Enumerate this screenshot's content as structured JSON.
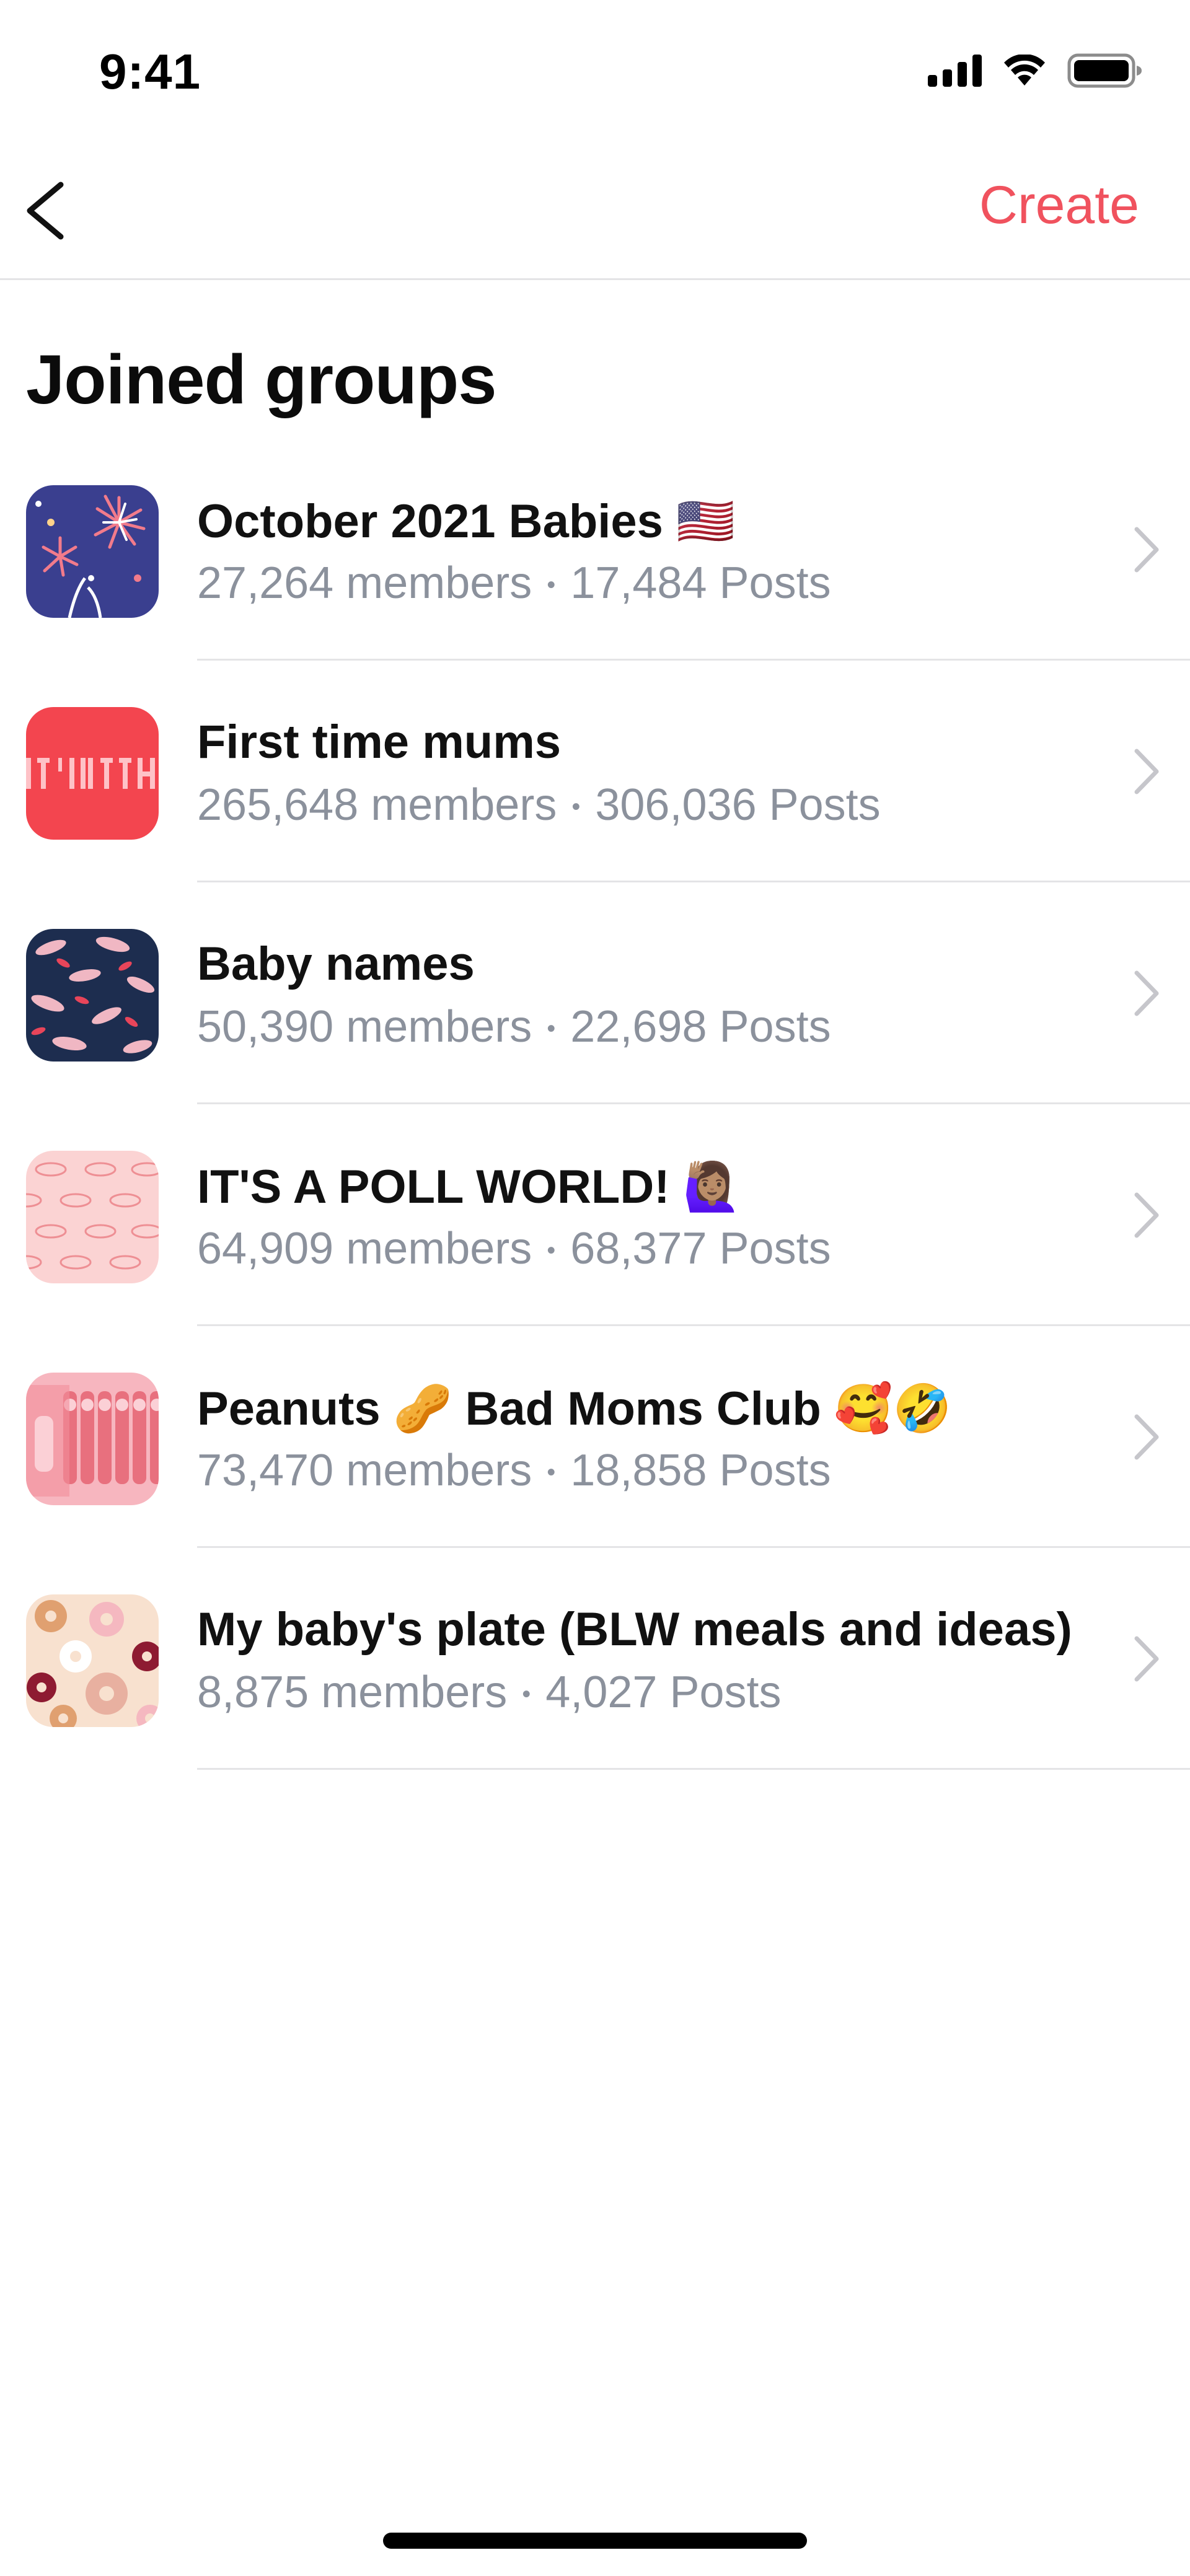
{
  "status_bar": {
    "time": "9:41"
  },
  "nav": {
    "back_icon": "chevron-left-icon",
    "create_label": "Create",
    "accent_color": "#f0525e"
  },
  "page": {
    "title": "Joined groups"
  },
  "groups": [
    {
      "name": "October 2021 Babies 🇺🇸",
      "members": "27,264 members",
      "posts": "17,484 Posts",
      "avatar": "fireworks-avatar"
    },
    {
      "name": "First time mums",
      "members": "265,648 members",
      "posts": "306,036 Posts",
      "avatar": "red-text-pattern-avatar"
    },
    {
      "name": "Baby names",
      "members": "50,390 members",
      "posts": "22,698 Posts",
      "avatar": "navy-lips-pattern-avatar"
    },
    {
      "name": "IT'S A POLL WORLD! 🙋🏽‍♀️",
      "members": "64,909 members",
      "posts": "68,377 Posts",
      "avatar": "pink-lips-pattern-avatar"
    },
    {
      "name": "Peanuts 🥜 Bad Moms Club 🥰🤣",
      "members": "73,470 members",
      "posts": "18,858 Posts",
      "avatar": "pink-figures-avatar"
    },
    {
      "name": "My baby's plate (BLW meals and ideas)",
      "members": "8,875 members",
      "posts": "4,027 Posts",
      "avatar": "donuts-avatar"
    }
  ],
  "separator": "•"
}
